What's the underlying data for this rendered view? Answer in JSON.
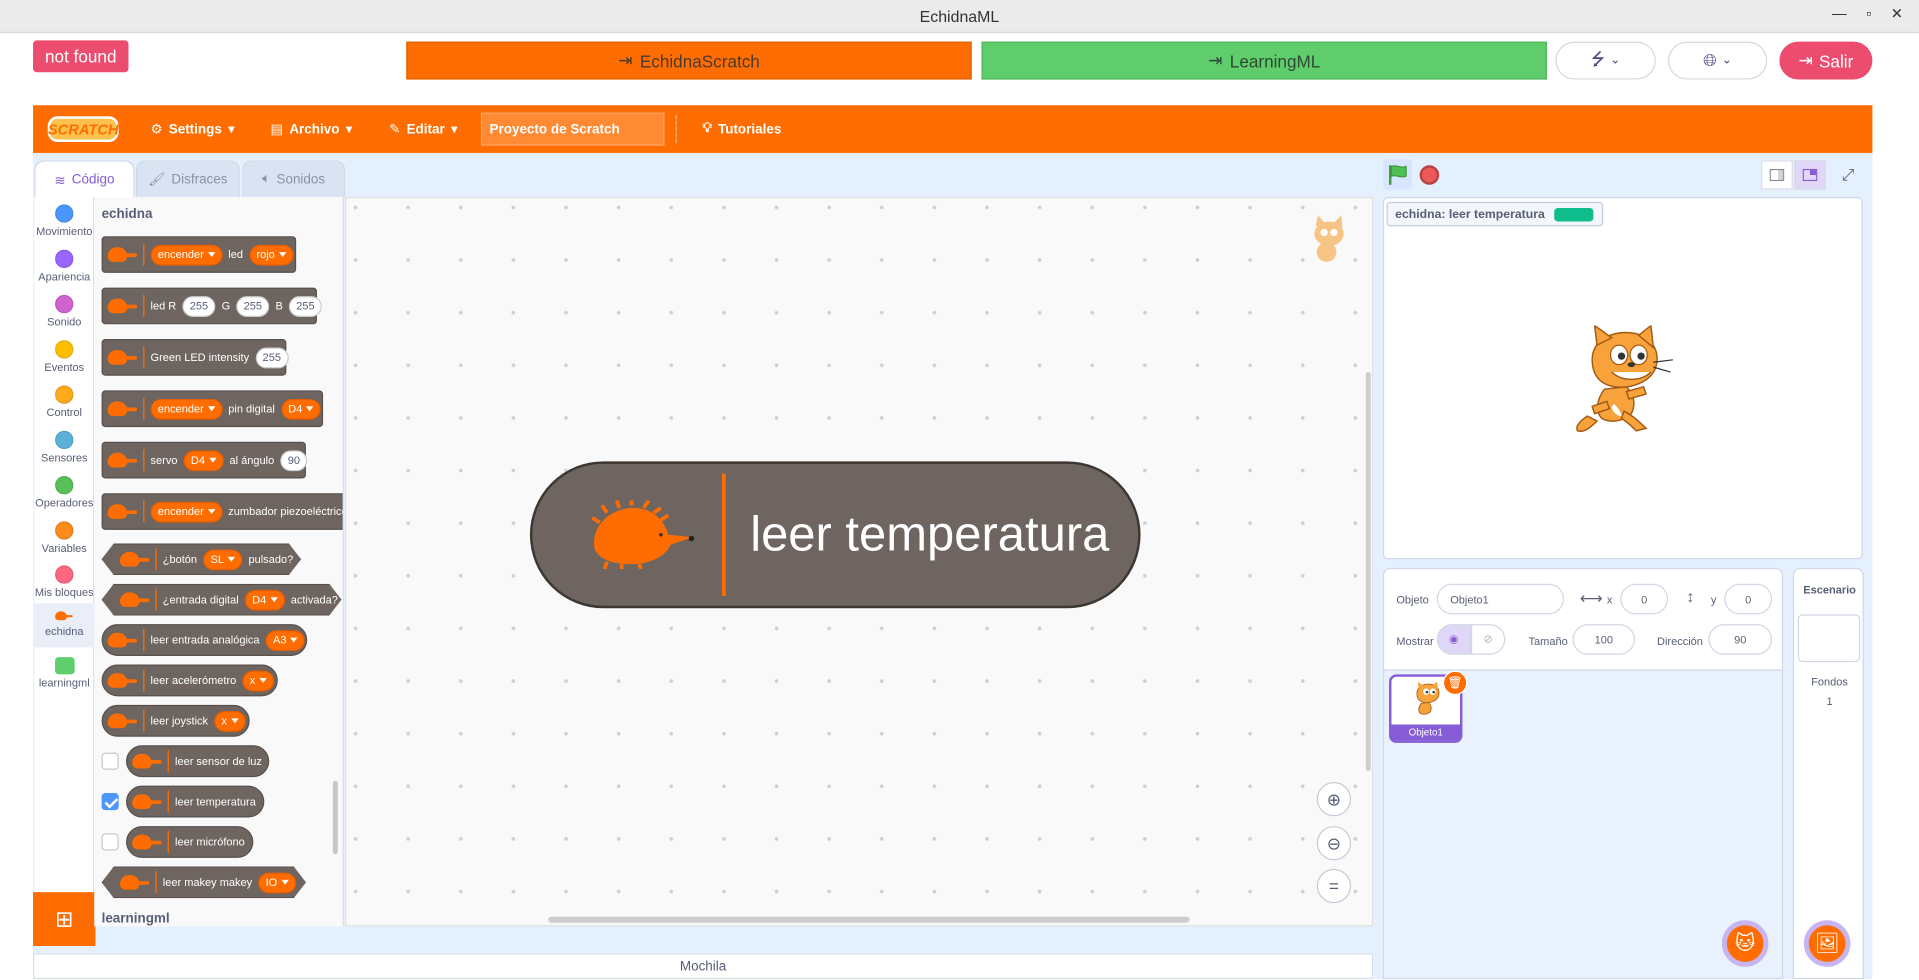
{
  "window": {
    "title": "EchidnaML"
  },
  "topbar": {
    "not_found": "not found",
    "echidna_scratch": "EchidnaScratch",
    "learningml": "LearningML",
    "salir": "Salir"
  },
  "menubar": {
    "logo": "SCRATCH",
    "settings": "Settings",
    "archivo": "Archivo",
    "editar": "Editar",
    "project_title": "Proyecto de Scratch",
    "tutoriales": "Tutoriales"
  },
  "tabs": {
    "code": "Código",
    "costumes": "Disfraces",
    "sounds": "Sonidos"
  },
  "categories": [
    {
      "label": "Movimiento",
      "color": "#4c97ff"
    },
    {
      "label": "Apariencia",
      "color": "#9966ff"
    },
    {
      "label": "Sonido",
      "color": "#cf63cf"
    },
    {
      "label": "Eventos",
      "color": "#ffbf00"
    },
    {
      "label": "Control",
      "color": "#ffab19"
    },
    {
      "label": "Sensores",
      "color": "#5cb1d6"
    },
    {
      "label": "Operadores",
      "color": "#59c059"
    },
    {
      "label": "Variables",
      "color": "#ff8c1a"
    },
    {
      "label": "Mis bloques",
      "color": "#ff6680"
    },
    {
      "label": "echidna",
      "color": "#ff6d00"
    },
    {
      "label": "learningml",
      "color": "#5fcd6b"
    }
  ],
  "palette": {
    "heading": "echidna",
    "heading2": "learningml",
    "b1": {
      "dd1": "encender",
      "t1": "led",
      "dd2": "rojo"
    },
    "b2": {
      "t1": "led R",
      "r": "255",
      "t2": "G",
      "g": "255",
      "t3": "B",
      "b": "255"
    },
    "b3": {
      "t1": "Green LED intensity",
      "v": "255"
    },
    "b4": {
      "dd1": "encender",
      "t1": "pin digital",
      "dd2": "D4"
    },
    "b5": {
      "t1": "servo",
      "dd1": "D4",
      "t2": "al ángulo",
      "v": "90"
    },
    "b6": {
      "dd1": "encender",
      "t1": "zumbador piezoeléctrico"
    },
    "b7": {
      "t1": "¿botón",
      "dd1": "SL",
      "t2": "pulsado?"
    },
    "b8": {
      "t1": "¿entrada digital",
      "dd1": "D4",
      "t2": "activada?"
    },
    "b9": {
      "t1": "leer entrada analógica",
      "dd1": "A3"
    },
    "b10": {
      "t1": "leer acelerómetro",
      "dd1": "x"
    },
    "b11": {
      "t1": "leer joystick",
      "dd1": "x"
    },
    "b12": {
      "t1": "leer sensor de luz"
    },
    "b13": {
      "t1": "leer temperatura"
    },
    "b14": {
      "t1": "leer micrófono"
    },
    "b15": {
      "t1": "leer makey makey",
      "dd1": "IO"
    }
  },
  "workspace": {
    "block_text": "leer temperatura"
  },
  "backpack": "Mochila",
  "stage": {
    "monitor_label": "echidna: leer temperatura"
  },
  "sprite_info": {
    "objeto_label": "Objeto",
    "objeto_value": "Objeto1",
    "x_label": "x",
    "x_value": "0",
    "y_label": "y",
    "y_value": "0",
    "mostrar_label": "Mostrar",
    "tamano_label": "Tamaño",
    "tamano_value": "100",
    "direccion_label": "Dirección",
    "direccion_value": "90"
  },
  "sprites": [
    {
      "name": "Objeto1"
    }
  ],
  "stage_panel": {
    "title": "Escenario",
    "fondos_label": "Fondos",
    "fondos_count": "1"
  }
}
